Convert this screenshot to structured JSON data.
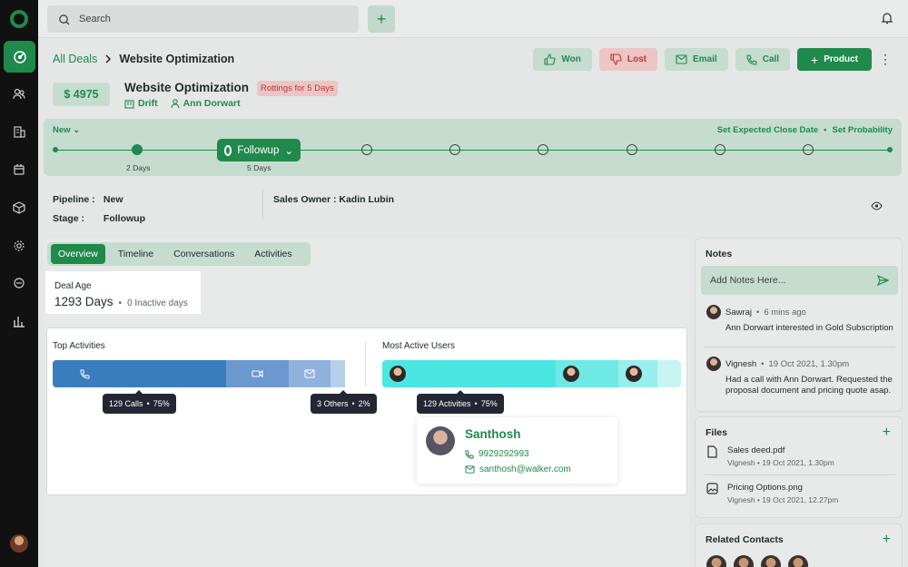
{
  "search": {
    "placeholder": "Search"
  },
  "breadcrumb": {
    "parent": "All Deals",
    "current": "Website Optimization"
  },
  "actions": {
    "won": "Won",
    "lost": "Lost",
    "email": "Email",
    "call": "Call",
    "product": "Product"
  },
  "deal": {
    "amount": "$ 4975",
    "title": "Website Optimization",
    "rot_badge": "Rottings for 5 Days",
    "company": "Drift",
    "contact": "Ann Dorwart"
  },
  "stages": {
    "current_group": "New",
    "set_close": "Set Expected Close Date",
    "sep": "•",
    "set_prob": "Set Probability",
    "current": "Followup",
    "past_label": "2 Days",
    "current_label": "5 Days"
  },
  "info": {
    "pipeline_label": "Pipeline :",
    "pipeline": "New",
    "stage_label": "Stage :",
    "stage": "Followup",
    "owner_label": "Sales Owner :",
    "owner": "Kadin Lubin"
  },
  "tabs": [
    "Overview",
    "Timeline",
    "Conversations",
    "Activities"
  ],
  "deal_age": {
    "label": "Deal Age",
    "value": "1293 Days",
    "dot": "•",
    "inactive": "0 Inactive days"
  },
  "top_activities": {
    "title": "Top Activities",
    "segments": [
      {
        "name": "calls",
        "percent": 58,
        "color": "#3a7dbf"
      },
      {
        "name": "meetings",
        "percent": 21,
        "color": "#6a98cf"
      },
      {
        "name": "emails",
        "percent": 14,
        "color": "#8fb2dc"
      },
      {
        "name": "others",
        "percent": 5,
        "color": "#b6cfea"
      }
    ],
    "calls_tip": "129 Calls",
    "calls_pct": "75%",
    "others_tip": "3 Others",
    "others_pct": "2%",
    "dot": "•"
  },
  "active_users": {
    "title": "Most Active Users",
    "segments": [
      {
        "percent": 58,
        "color": "#4ce6e2"
      },
      {
        "percent": 21,
        "color": "#6ee9e6"
      },
      {
        "percent": 13,
        "color": "#97eeec"
      },
      {
        "percent": 8,
        "color": "#c7f5f4"
      }
    ],
    "tip": "129 Activities",
    "tip_pct": "75%",
    "dot": "•",
    "card": {
      "name": "Santhosh",
      "phone": "9929292993",
      "email": "santhosh@walker.com"
    }
  },
  "notes": {
    "title": "Notes",
    "placeholder": "Add Notes Here...",
    "items": [
      {
        "author": "Sawraj",
        "dot": "•",
        "time": "6 mins ago",
        "text": "Ann Dorwart interested in Gold Subscription"
      },
      {
        "author": "Vignesh",
        "dot": "•",
        "time": "19 Oct 2021, 1.30pm",
        "text": "Had a call with Ann Dorwart. Requested the proposal document and pricing quote asap."
      }
    ]
  },
  "files": {
    "title": "Files",
    "items": [
      {
        "name": "Sales deed.pdf",
        "meta": "Vignesh  •  19 Oct 2021, 1.30pm"
      },
      {
        "name": "Pricing Options.png",
        "meta": "Vignesh  •  19 Oct 2021, 12.27pm"
      }
    ]
  },
  "related": {
    "title": "Related Contacts"
  },
  "colors": {
    "brand": "#1f8a4c",
    "danger": "#c23434",
    "brand_light": "#c6dccf"
  }
}
